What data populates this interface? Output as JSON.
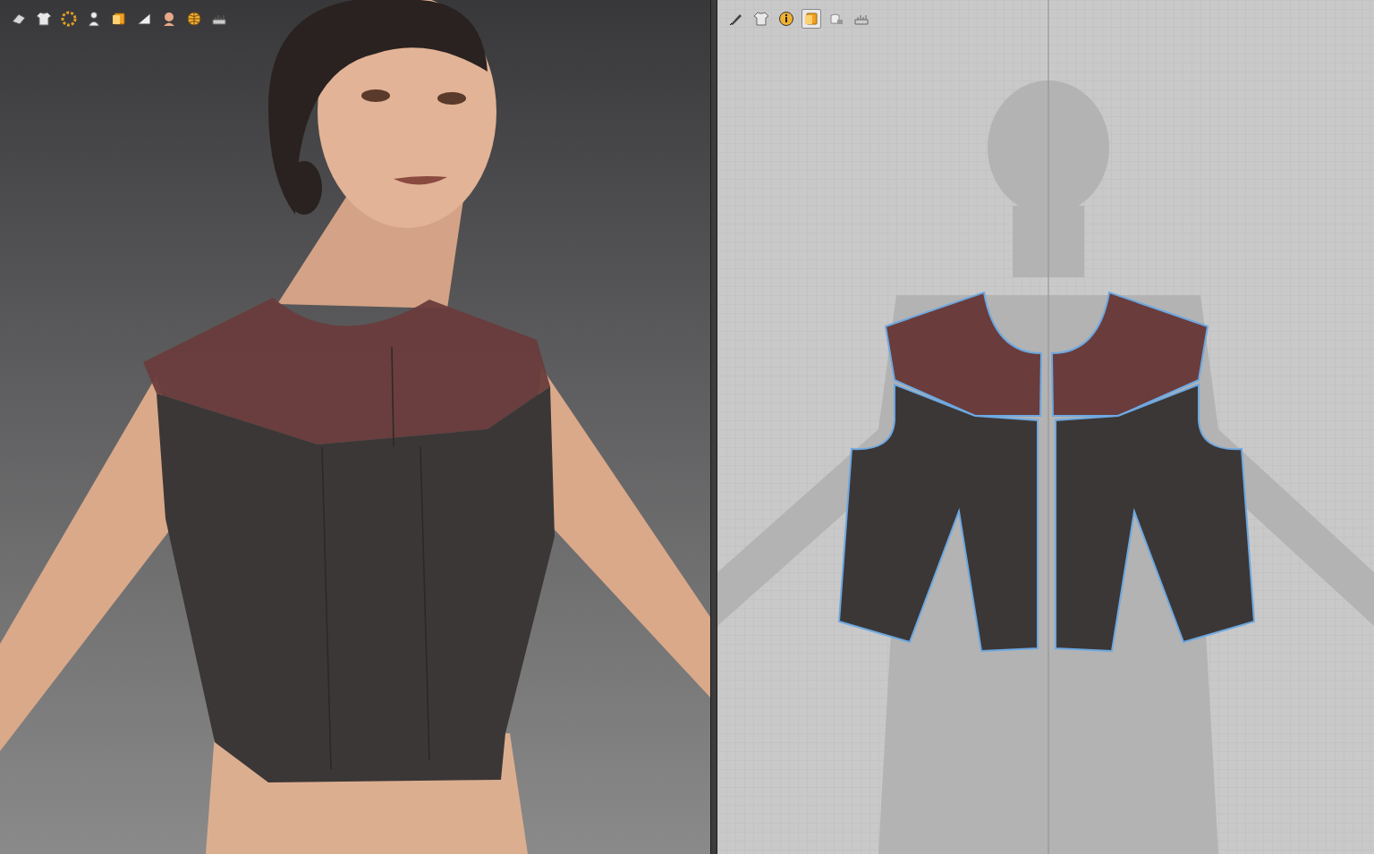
{
  "viewport_3d": {
    "toolbar": [
      {
        "kind": "render",
        "selected": false
      },
      {
        "kind": "garment",
        "selected": false
      },
      {
        "kind": "points",
        "selected": false
      },
      {
        "kind": "avatar",
        "selected": false
      },
      {
        "kind": "texture",
        "selected": false
      },
      {
        "kind": "fabric",
        "selected": false
      },
      {
        "kind": "skin",
        "selected": false
      },
      {
        "kind": "globe",
        "selected": false
      },
      {
        "kind": "measure",
        "selected": false
      }
    ]
  },
  "pattern_2d": {
    "toolbar": [
      {
        "kind": "pen",
        "selected": false
      },
      {
        "kind": "garment",
        "selected": false
      },
      {
        "kind": "info",
        "selected": false
      },
      {
        "kind": "texture",
        "selected": true
      },
      {
        "kind": "lock",
        "selected": false
      },
      {
        "kind": "measure",
        "selected": false
      }
    ]
  },
  "pieces": [
    {
      "kind": "yoke",
      "side": "left",
      "color": "#6a3c3c",
      "selected": true
    },
    {
      "kind": "yoke",
      "side": "right",
      "color": "#6a3c3c",
      "selected": true
    },
    {
      "kind": "body",
      "side": "left",
      "color": "#3b3737",
      "selected": true
    },
    {
      "kind": "body",
      "side": "right",
      "color": "#3b3737",
      "selected": true
    }
  ]
}
